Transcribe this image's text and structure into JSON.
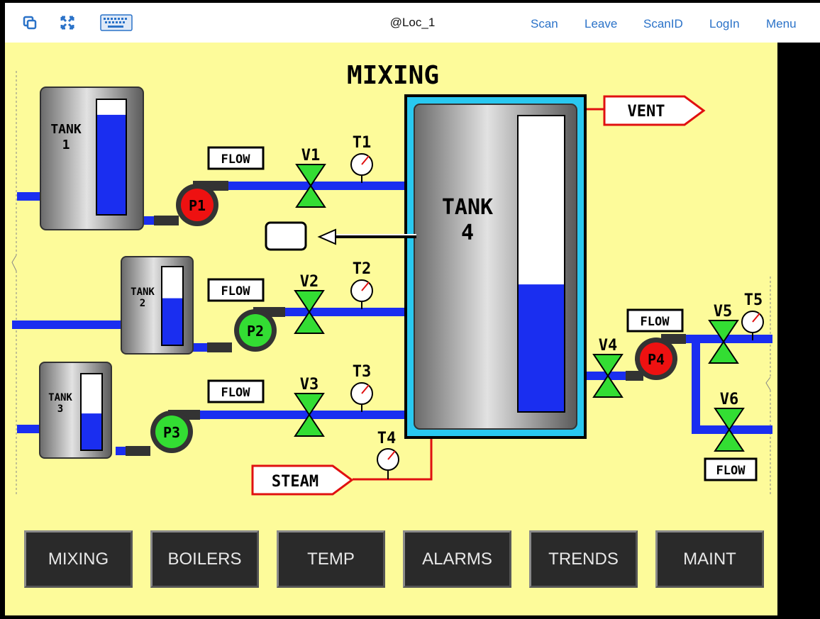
{
  "topbar": {
    "icons": [
      "copy-icon",
      "fullscreen-icon",
      "keyboard-icon"
    ],
    "title": "@Loc_1",
    "links": [
      "Scan",
      "Leave",
      "ScanID",
      "LogIn",
      "Menu"
    ]
  },
  "screen": {
    "title": "MIXING",
    "tanks": {
      "tank1": {
        "name": "TANK",
        "num": "1",
        "level": 0.87
      },
      "tank2": {
        "name": "TANK",
        "num": "2",
        "level": 0.6
      },
      "tank3": {
        "name": "TANK",
        "num": "3",
        "level": 0.48
      },
      "tank4": {
        "name": "TANK",
        "num": "4",
        "level": 0.43
      }
    },
    "pumps": [
      {
        "label": "P1",
        "state": "stopped"
      },
      {
        "label": "P2",
        "state": "running"
      },
      {
        "label": "P3",
        "state": "running"
      },
      {
        "label": "P4",
        "state": "stopped"
      }
    ],
    "valves": [
      "V1",
      "V2",
      "V3",
      "V4",
      "V5",
      "V6"
    ],
    "gauges": [
      "T1",
      "T2",
      "T3",
      "T4",
      "T5"
    ],
    "flow_label": "FLOW",
    "vent_label": "VENT",
    "steam_label": "STEAM"
  },
  "nav": [
    "MIXING",
    "BOILERS",
    "TEMP",
    "ALARMS",
    "TRENDS",
    "MAINT"
  ],
  "colors": {
    "background": "#fdfb9a",
    "pipe": "#1a2ef0",
    "running": "#33dd33",
    "stopped": "#ee1111",
    "valve": "#33dd33",
    "vessel_frame": "#29c8f0",
    "steam_line": "#e01010",
    "link": "#2a72c8"
  }
}
